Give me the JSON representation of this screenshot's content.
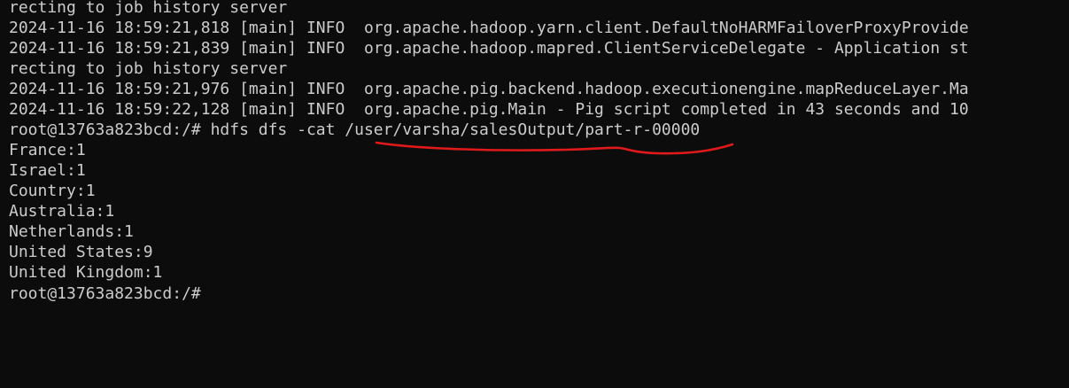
{
  "terminal": {
    "lines": [
      "recting to job history server",
      "2024-11-16 18:59:21,818 [main] INFO  org.apache.hadoop.yarn.client.DefaultNoHARMFailoverProxyProvide",
      "2024-11-16 18:59:21,839 [main] INFO  org.apache.hadoop.mapred.ClientServiceDelegate - Application st",
      "recting to job history server",
      "2024-11-16 18:59:21,976 [main] INFO  org.apache.pig.backend.hadoop.executionengine.mapReduceLayer.Ma",
      "2024-11-16 18:59:22,128 [main] INFO  org.apache.pig.Main - Pig script completed in 43 seconds and 10",
      "root@13763a823bcd:/# hdfs dfs -cat /user/varsha/salesOutput/part-r-00000",
      "France:1",
      "Israel:1",
      "Country:1",
      "Australia:1",
      "Netherlands:1",
      "United States:9",
      "United Kingdom:1"
    ],
    "prompt": "root@13763a823bcd:/# ",
    "colors": {
      "background": "#0c0c0c",
      "foreground": "#cccccc",
      "annotation": "#e0191b"
    }
  }
}
